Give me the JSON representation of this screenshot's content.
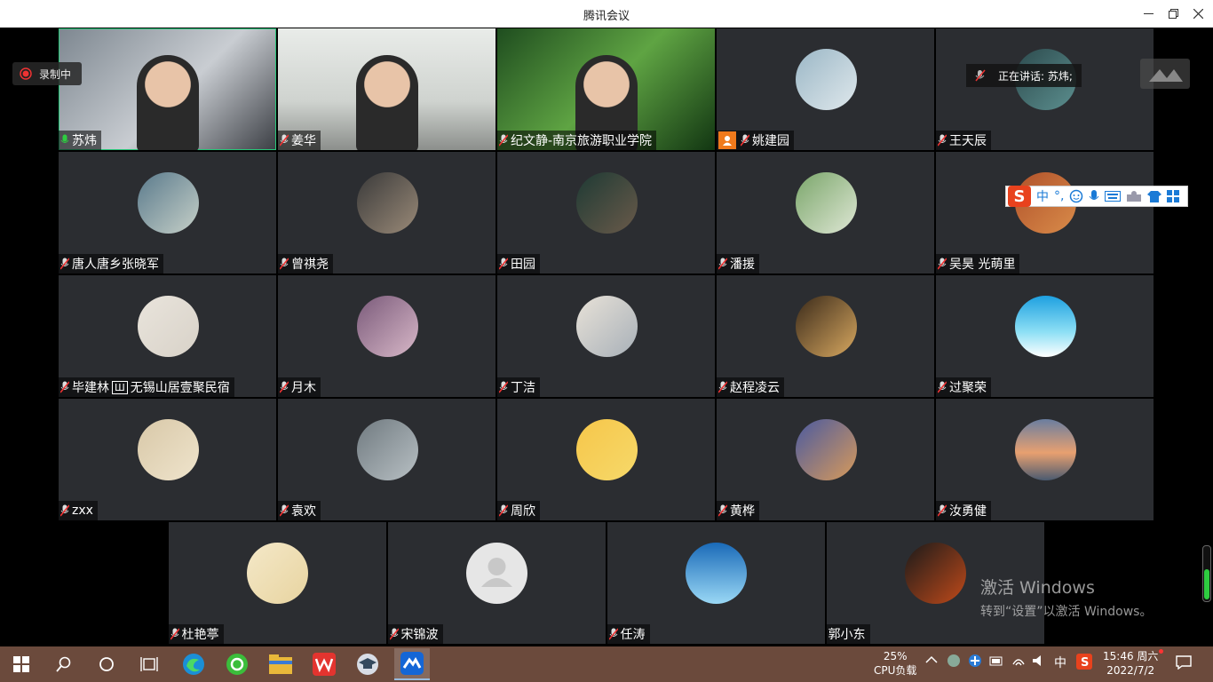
{
  "app": {
    "window_title": "腾讯会议",
    "recording_label": "录制中",
    "speaking_label": "正在讲话: 苏炜;"
  },
  "participants": [
    {
      "name": "苏炜",
      "kind": "video",
      "mic": "on"
    },
    {
      "name": "姜华",
      "kind": "video",
      "mic": "off"
    },
    {
      "name": "纪文静-南京旅游职业学院",
      "kind": "video",
      "mic": "off"
    },
    {
      "name": "姚建园",
      "kind": "avatar",
      "mic": "off",
      "host": true
    },
    {
      "name": "王天辰",
      "kind": "avatar",
      "mic": "off"
    },
    {
      "name": "唐人唐乡张晓军",
      "kind": "avatar",
      "mic": "off"
    },
    {
      "name": "曾祺尧",
      "kind": "avatar",
      "mic": "off"
    },
    {
      "name": "田园",
      "kind": "avatar",
      "mic": "off"
    },
    {
      "name": "潘援",
      "kind": "avatar",
      "mic": "off"
    },
    {
      "name": "吴昊 光萌里",
      "kind": "avatar",
      "mic": "off"
    },
    {
      "name": "毕建林",
      "kind": "avatar",
      "mic": "off",
      "badge": "Ш",
      "suffix": "无锡山居壹聚民宿"
    },
    {
      "name": "月木",
      "kind": "avatar",
      "mic": "off"
    },
    {
      "name": "丁洁",
      "kind": "avatar",
      "mic": "off"
    },
    {
      "name": "赵程凌云",
      "kind": "avatar",
      "mic": "off"
    },
    {
      "name": "过聚荣",
      "kind": "avatar",
      "mic": "off"
    },
    {
      "name": "zxx",
      "kind": "avatar",
      "mic": "off"
    },
    {
      "name": "袁欢",
      "kind": "avatar",
      "mic": "off"
    },
    {
      "name": "周欣",
      "kind": "avatar",
      "mic": "off"
    },
    {
      "name": "黄桦",
      "kind": "avatar",
      "mic": "off"
    },
    {
      "name": "汝勇健",
      "kind": "avatar",
      "mic": "off"
    },
    {
      "name": "杜艳葶",
      "kind": "avatar",
      "mic": "off"
    },
    {
      "name": "宋锦波",
      "kind": "avatar",
      "mic": "off"
    },
    {
      "name": "任涛",
      "kind": "avatar",
      "mic": "off"
    },
    {
      "name": "郭小东",
      "kind": "avatar",
      "mic": "none"
    }
  ],
  "ime": {
    "mode": "中",
    "punct": "°,"
  },
  "watermark": {
    "line1": "激活 Windows",
    "line2": "转到“设置”以激活 Windows。"
  },
  "taskbar": {
    "cpu_percent": "25%",
    "cpu_label": "CPU负载",
    "ime_lang": "中",
    "time": "15:46 周六",
    "date": "2022/7/2"
  },
  "colors": {
    "tile_bg": "#2b2d31",
    "active_border": "#29c77a",
    "taskbar": "#6b4a3c"
  }
}
